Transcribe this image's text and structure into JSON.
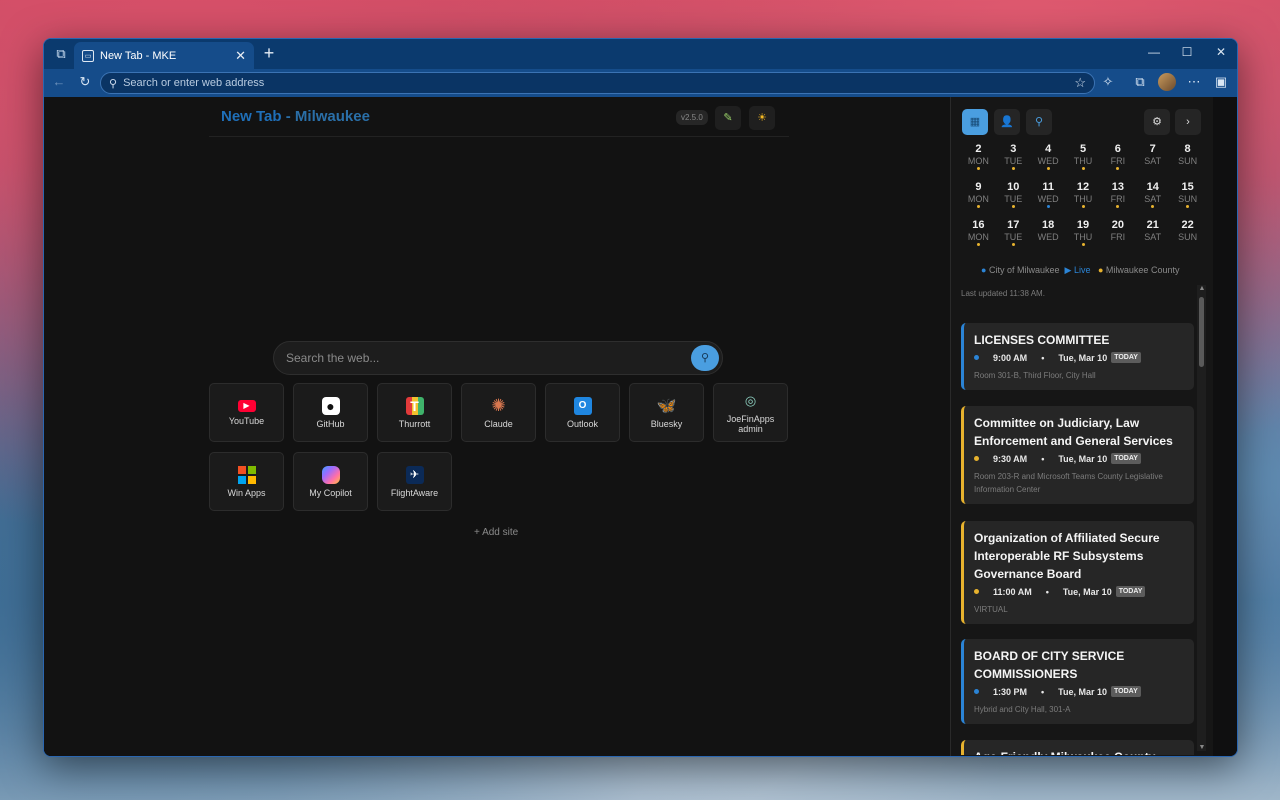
{
  "browser": {
    "tab_title": "New Tab - MKE",
    "address_placeholder": "Search or enter web address"
  },
  "page": {
    "title_main": "New Tab",
    "title_sep": " - ",
    "title_city": "Milwaukee",
    "version": "v2.5.0",
    "search_placeholder": "Search the web...",
    "add_site": "+ Add site"
  },
  "tiles": [
    {
      "label": "YouTube",
      "icon": "youtube-icon",
      "color": "#ff0033"
    },
    {
      "label": "GitHub",
      "icon": "github-icon",
      "color": "#ffffff"
    },
    {
      "label": "Thurrott",
      "icon": "thurrott-icon",
      "color": "#e23a3a"
    },
    {
      "label": "Claude",
      "icon": "claude-icon",
      "color": "#d9774f"
    },
    {
      "label": "Outlook",
      "icon": "outlook-icon",
      "color": "#1f86e0"
    },
    {
      "label": "Bluesky",
      "icon": "bluesky-icon",
      "color": "#2f8cff"
    },
    {
      "label": "JoeFinApps admin",
      "icon": "joefinapps-icon",
      "color": "#8fd3c3"
    },
    {
      "label": "Win Apps",
      "icon": "windows-icon",
      "color": "#00a4ef"
    },
    {
      "label": "My Copilot",
      "icon": "copilot-icon",
      "color": "#9b6bff"
    },
    {
      "label": "FlightAware",
      "icon": "flightaware-icon",
      "color": "#0b2a57"
    }
  ],
  "calendar": {
    "weeks": [
      [
        {
          "n": "2",
          "d": "MON",
          "dot": "#e7b22e"
        },
        {
          "n": "3",
          "d": "TUE",
          "dot": "#e7b22e"
        },
        {
          "n": "4",
          "d": "WED",
          "dot": "#e7b22e"
        },
        {
          "n": "5",
          "d": "THU",
          "dot": "#e7b22e"
        },
        {
          "n": "6",
          "d": "FRI",
          "dot": "#e7b22e"
        },
        {
          "n": "7",
          "d": "SAT",
          "dot": ""
        },
        {
          "n": "8",
          "d": "SUN",
          "dot": ""
        }
      ],
      [
        {
          "n": "9",
          "d": "MON",
          "dot": "#e7b22e"
        },
        {
          "n": "10",
          "d": "TUE",
          "dot": "#e7b22e"
        },
        {
          "n": "11",
          "d": "WED",
          "dot": "#2b84d6"
        },
        {
          "n": "12",
          "d": "THU",
          "dot": "#e7b22e"
        },
        {
          "n": "13",
          "d": "FRI",
          "dot": "#e7b22e"
        },
        {
          "n": "14",
          "d": "SAT",
          "dot": "#e7b22e"
        },
        {
          "n": "15",
          "d": "SUN",
          "dot": "#e7b22e"
        }
      ],
      [
        {
          "n": "16",
          "d": "MON",
          "dot": "#e7b22e"
        },
        {
          "n": "17",
          "d": "TUE",
          "dot": "#e7b22e"
        },
        {
          "n": "18",
          "d": "WED",
          "dot": ""
        },
        {
          "n": "19",
          "d": "THU",
          "dot": "#e7b22e"
        },
        {
          "n": "20",
          "d": "FRI",
          "dot": ""
        },
        {
          "n": "21",
          "d": "SAT",
          "dot": ""
        },
        {
          "n": "22",
          "d": "SUN",
          "dot": ""
        }
      ]
    ],
    "legend": {
      "city": "City of Milwaukee",
      "live": "Live",
      "county": "Milwaukee County"
    },
    "last_updated": "Last updated 11:38 AM."
  },
  "events": [
    {
      "title": "LICENSES COMMITTEE",
      "time": "9:00 AM",
      "date": "Tue, Mar 10",
      "badge": "TODAY",
      "location": "Room 301-B, Third Floor, City Hall",
      "type": "city"
    },
    {
      "title": "Committee on Judiciary, Law Enforcement and General Services",
      "time": "9:30 AM",
      "date": "Tue, Mar 10",
      "badge": "TODAY",
      "location": "Room 203-R and Microsoft Teams County Legislative Information Center",
      "type": "county"
    },
    {
      "title": "Organization of Affiliated Secure Interoperable RF Subsystems Governance Board",
      "time": "11:00 AM",
      "date": "Tue, Mar 10",
      "badge": "TODAY",
      "location": "VIRTUAL",
      "type": "county"
    },
    {
      "title": "BOARD OF CITY SERVICE COMMISSIONERS",
      "time": "1:30 PM",
      "date": "Tue, Mar 10",
      "badge": "TODAY",
      "location": "Hybrid and City Hall, 301-A",
      "type": "city"
    },
    {
      "title": "Age-Friendly Milwaukee County",
      "time": "",
      "date": "",
      "badge": "",
      "location": "",
      "type": "county"
    }
  ],
  "colors": {
    "city": "#2b84d6",
    "county": "#e7b22e",
    "accent": "#4a9ee0"
  }
}
